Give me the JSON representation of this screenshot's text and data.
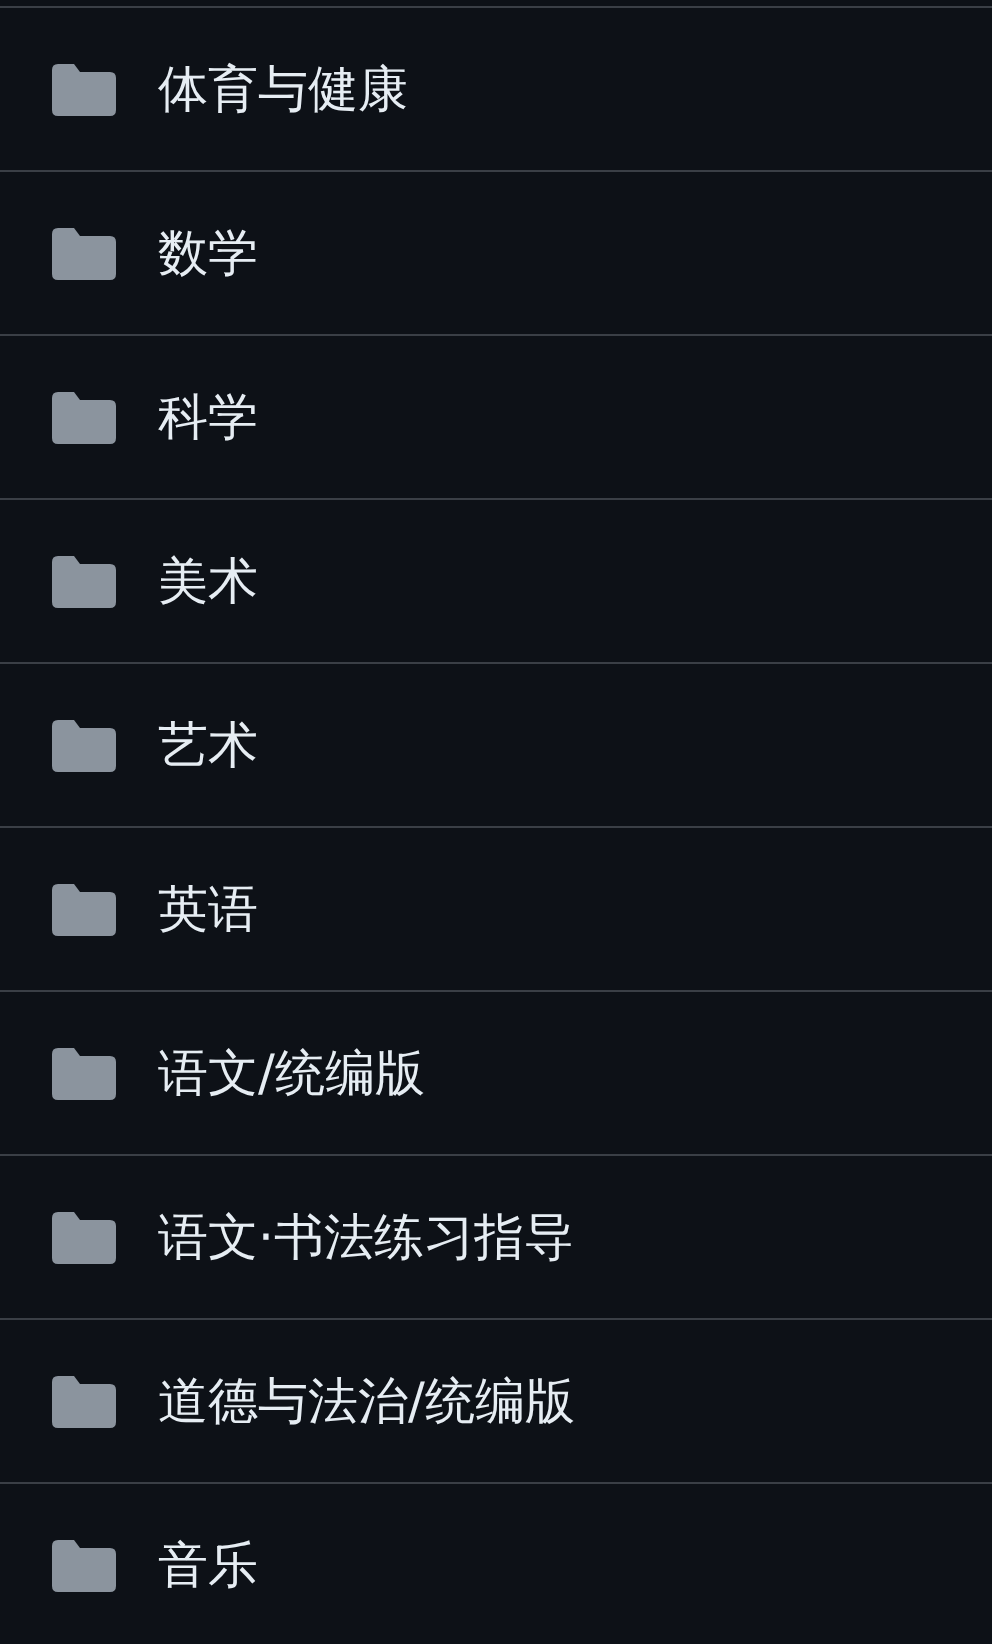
{
  "folders": [
    {
      "name": "体育与健康"
    },
    {
      "name": "数学"
    },
    {
      "name": "科学"
    },
    {
      "name": "美术"
    },
    {
      "name": "艺术"
    },
    {
      "name": "英语"
    },
    {
      "name": "语文/统编版"
    },
    {
      "name": "语文·书法练习指导"
    },
    {
      "name": "道德与法治/统编版"
    },
    {
      "name": "音乐"
    }
  ]
}
